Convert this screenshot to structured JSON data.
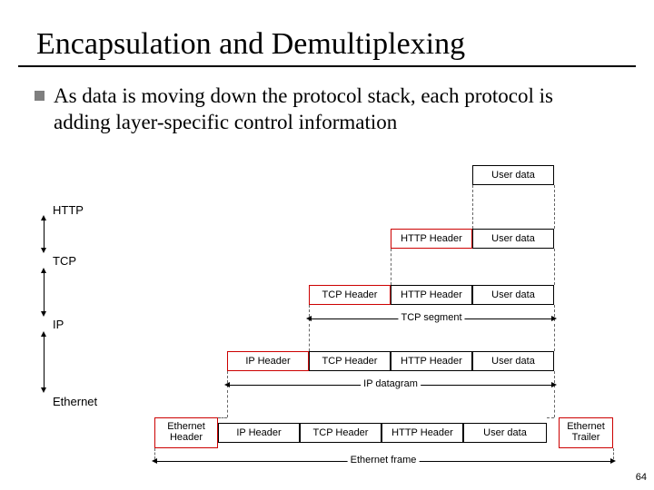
{
  "title": "Encapsulation and Demultiplexing",
  "body": "As data is moving down the protocol stack, each protocol is adding layer-specific control information",
  "layers": {
    "http": "HTTP",
    "tcp": "TCP",
    "ip": "IP",
    "eth": "Ethernet"
  },
  "boxes": {
    "user_data": "User data",
    "http_header": "HTTP Header",
    "tcp_header": "TCP Header",
    "ip_header": "IP Header",
    "eth_header": "Ethernet Header",
    "eth_trailer": "Ethernet Trailer"
  },
  "spans": {
    "tcp_segment": "TCP segment",
    "ip_datagram": "IP datagram",
    "eth_frame": "Ethernet frame"
  },
  "slide_number": "64"
}
